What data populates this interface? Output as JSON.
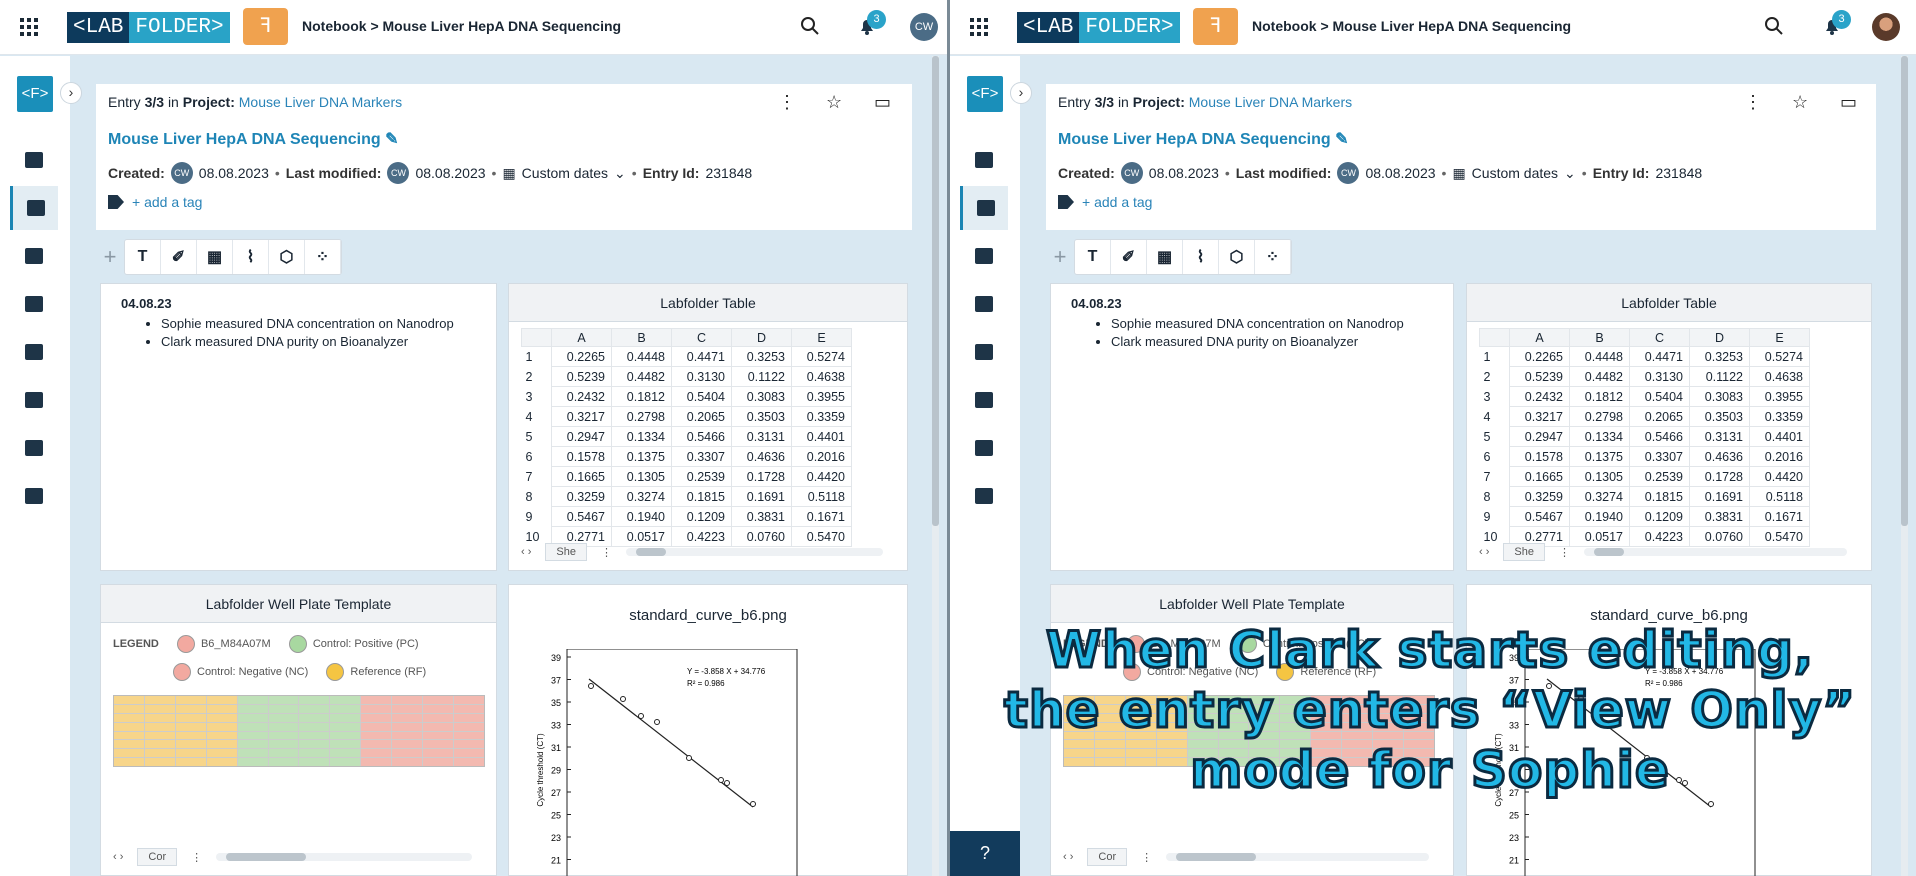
{
  "app": {
    "logo_left": "<LAB",
    "logo_right": "FOLDER>",
    "app_icon": "ꟻ"
  },
  "breadcrumb": "Notebook > Mouse Liver HepA DNA Sequencing",
  "notifications": {
    "count": "3"
  },
  "user_initials": "CW",
  "sidebar": {
    "logo": "<F>"
  },
  "entry": {
    "prefix": "Entry",
    "position": "3/3",
    "in": "in",
    "project_label": "Project:",
    "project_name": "Mouse Liver DNA Markers",
    "title": "Mouse Liver HepA DNA Sequencing",
    "created_label": "Created:",
    "created_date": "08.08.2023",
    "modified_label": "Last modified:",
    "modified_date": "08.08.2023",
    "custom_dates": "Custom dates",
    "id_label": "Entry Id:",
    "id_value": "231848",
    "add_tag": "+ add a tag"
  },
  "note": {
    "date": "04.08.23",
    "items": [
      "Sophie measured DNA concentration on Nanodrop",
      "Clark measured DNA purity on Bioanalyzer"
    ]
  },
  "table": {
    "title": "Labfolder Table",
    "columns": [
      "A",
      "B",
      "C",
      "D",
      "E"
    ],
    "rows": [
      [
        "0.2265",
        "0.4448",
        "0.4471",
        "0.3253",
        "0.5274"
      ],
      [
        "0.5239",
        "0.4482",
        "0.3130",
        "0.1122",
        "0.4638"
      ],
      [
        "0.2432",
        "0.1812",
        "0.5404",
        "0.3083",
        "0.3955"
      ],
      [
        "0.3217",
        "0.2798",
        "0.2065",
        "0.3503",
        "0.3359"
      ],
      [
        "0.2947",
        "0.1334",
        "0.5466",
        "0.3131",
        "0.4401"
      ],
      [
        "0.1578",
        "0.1375",
        "0.3307",
        "0.4636",
        "0.2016"
      ],
      [
        "0.1665",
        "0.1305",
        "0.2539",
        "0.1728",
        "0.4420"
      ],
      [
        "0.3259",
        "0.3274",
        "0.1815",
        "0.1691",
        "0.5118"
      ],
      [
        "0.5467",
        "0.1940",
        "0.1209",
        "0.3831",
        "0.1671"
      ],
      [
        "0.2771",
        "0.0517",
        "0.4223",
        "0.0760",
        "0.5470"
      ]
    ],
    "sheet_tab": "She"
  },
  "wellplate": {
    "title": "Labfolder Well Plate Template",
    "legend_label": "LEGEND",
    "legend": [
      {
        "label": "B6_M84A07M",
        "color": "#f2a9a0"
      },
      {
        "label": "Control: Positive (PC)",
        "color": "#a8d8a0"
      },
      {
        "label": "Control: Negative (NC)",
        "color": "#f2a9a0"
      },
      {
        "label": "Reference (RF)",
        "color": "#f5c542"
      }
    ],
    "sheet_tab": "Cor"
  },
  "image": {
    "title": "standard_curve_b6.png",
    "equation": "Y = -3.858 X + 34.776",
    "r2": "R² = 0.986",
    "ylabel": "Cycle threshold (CT)",
    "yticks": [
      "39",
      "37",
      "35",
      "33",
      "31",
      "29",
      "27",
      "25",
      "23",
      "21"
    ]
  },
  "overlay_text": [
    "When Clark starts editing,",
    "the entry enters “View Only”",
    "mode for Sophie"
  ],
  "colors": {
    "accent": "#1e85b6",
    "brand_dark": "#0d3a5c",
    "brand_light": "#29a3c7",
    "app_orange": "#f0a24f"
  }
}
